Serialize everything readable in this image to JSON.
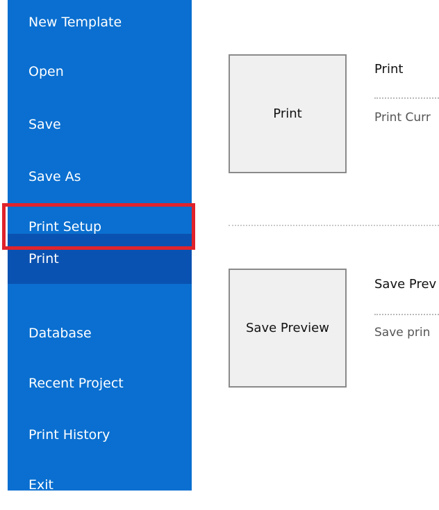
{
  "sidebar": {
    "items": [
      {
        "label": "New Template"
      },
      {
        "label": "Open"
      },
      {
        "label": "Save"
      },
      {
        "label": "Save As"
      },
      {
        "label": "Print Setup"
      },
      {
        "label": "Print"
      },
      {
        "label": "Database"
      },
      {
        "label": "Recent Project"
      },
      {
        "label": "Print History"
      },
      {
        "label": "Exit"
      }
    ],
    "selected": "Print",
    "highlighted": "Print Setup"
  },
  "actions": [
    {
      "button_label": "Print",
      "title": "Print",
      "description": "Print Curr"
    },
    {
      "button_label": "Save Preview",
      "title": "Save Prev",
      "description": "Save prin"
    }
  ],
  "colors": {
    "sidebar_bg": "#0a6fd0",
    "sidebar_selected_bg": "#0a52b1",
    "highlight_border": "#e0232b"
  }
}
